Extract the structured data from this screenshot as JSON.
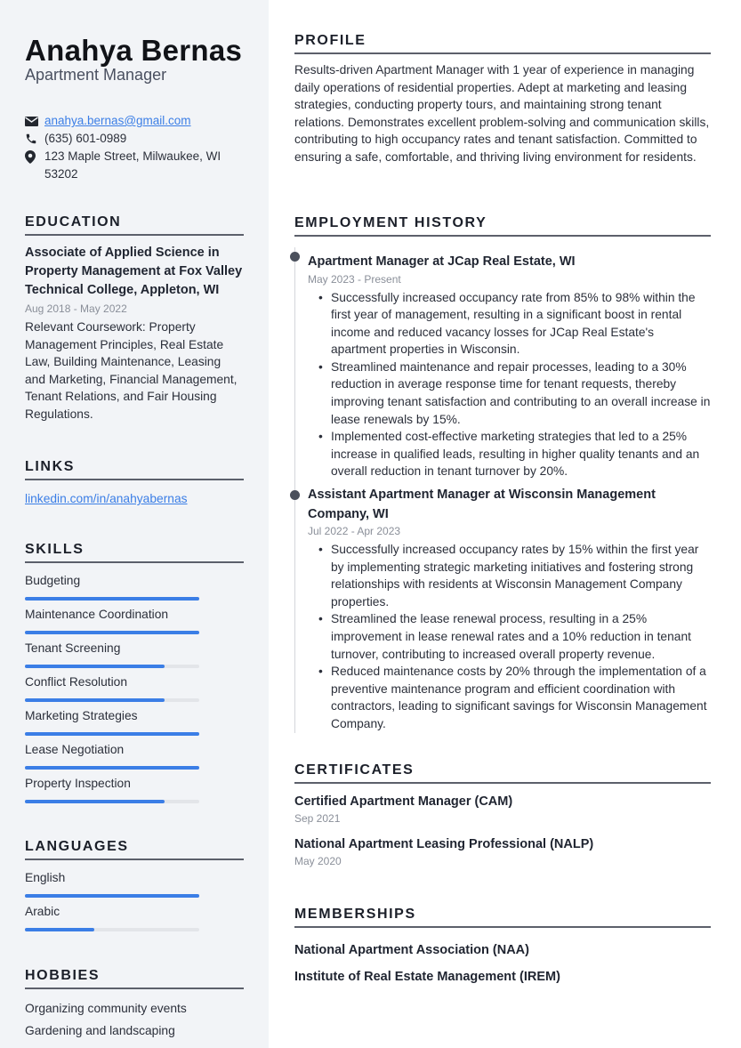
{
  "header": {
    "name": "Anahya Bernas",
    "title": "Apartment Manager"
  },
  "contact": {
    "email": "anahya.bernas@gmail.com",
    "phone": "(635) 601-0989",
    "address": "123 Maple Street, Milwaukee, WI 53202"
  },
  "education": {
    "heading": "EDUCATION",
    "degree": "Associate of Applied Science in Property Management at Fox Valley Technical College, Appleton, WI",
    "dates": "Aug 2018 - May 2022",
    "description": "Relevant Coursework: Property Management Principles, Real Estate Law, Building Maintenance, Leasing and Marketing, Financial Management, Tenant Relations, and Fair Housing Regulations."
  },
  "links": {
    "heading": "LINKS",
    "items": [
      {
        "label": "linkedin.com/in/anahyabernas"
      }
    ]
  },
  "skills": {
    "heading": "SKILLS",
    "items": [
      {
        "label": "Budgeting",
        "level": 1.0
      },
      {
        "label": "Maintenance Coordination",
        "level": 1.0
      },
      {
        "label": "Tenant Screening",
        "level": 0.8
      },
      {
        "label": "Conflict Resolution",
        "level": 0.8
      },
      {
        "label": "Marketing Strategies",
        "level": 1.0
      },
      {
        "label": "Lease Negotiation",
        "level": 1.0
      },
      {
        "label": "Property Inspection",
        "level": 0.8
      }
    ]
  },
  "languages": {
    "heading": "LANGUAGES",
    "items": [
      {
        "label": "English",
        "level": 1.0
      },
      {
        "label": "Arabic",
        "level": 0.4
      }
    ]
  },
  "hobbies": {
    "heading": "HOBBIES",
    "items": [
      "Organizing community events",
      "Gardening and landscaping"
    ]
  },
  "profile": {
    "heading": "PROFILE",
    "text": "Results-driven Apartment Manager with 1 year of experience in managing daily operations of residential properties. Adept at marketing and leasing strategies, conducting property tours, and maintaining strong tenant relations. Demonstrates excellent problem-solving and communication skills, contributing to high occupancy rates and tenant satisfaction. Committed to ensuring a safe, comfortable, and thriving living environment for residents."
  },
  "employment": {
    "heading": "EMPLOYMENT HISTORY",
    "jobs": [
      {
        "title": "Apartment Manager at JCap Real Estate, WI",
        "dates": "May 2023 - Present",
        "bullets": [
          "Successfully increased occupancy rate from 85% to 98% within the first year of management, resulting in a significant boost in rental income and reduced vacancy losses for JCap Real Estate's apartment properties in Wisconsin.",
          "Streamlined maintenance and repair processes, leading to a 30% reduction in average response time for tenant requests, thereby improving tenant satisfaction and contributing to an overall increase in lease renewals by 15%.",
          "Implemented cost-effective marketing strategies that led to a 25% increase in qualified leads, resulting in higher quality tenants and an overall reduction in tenant turnover by 20%."
        ]
      },
      {
        "title": "Assistant Apartment Manager at Wisconsin Management Company, WI",
        "dates": "Jul 2022 - Apr 2023",
        "bullets": [
          "Successfully increased occupancy rates by 15% within the first year by implementing strategic marketing initiatives and fostering strong relationships with residents at Wisconsin Management Company properties.",
          "Streamlined the lease renewal process, resulting in a 25% improvement in lease renewal rates and a 10% reduction in tenant turnover, contributing to increased overall property revenue.",
          "Reduced maintenance costs by 20% through the implementation of a preventive maintenance program and efficient coordination with contractors, leading to significant savings for Wisconsin Management Company."
        ]
      }
    ]
  },
  "certificates": {
    "heading": "CERTIFICATES",
    "items": [
      {
        "title": "Certified Apartment Manager (CAM)",
        "date": "Sep 2021"
      },
      {
        "title": "National Apartment Leasing Professional (NALP)",
        "date": "May 2020"
      }
    ]
  },
  "memberships": {
    "heading": "MEMBERSHIPS",
    "items": [
      "National Apartment Association (NAA)",
      "Institute of Real Estate Management (IREM)"
    ]
  },
  "colors": {
    "accent": "#3b7ee6",
    "sidebar_bg": "#f2f4f7",
    "bar_track": "#e3e5e9"
  }
}
